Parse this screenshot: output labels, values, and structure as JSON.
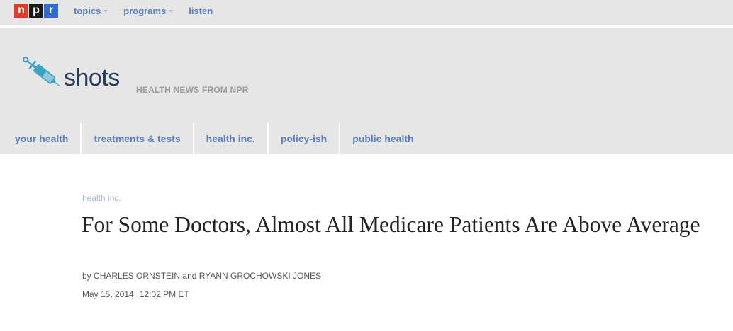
{
  "topbar": {
    "logo": {
      "n": "n",
      "p": "p",
      "r": "r"
    },
    "nav": [
      {
        "label": "topics",
        "has_dropdown": true
      },
      {
        "label": "programs",
        "has_dropdown": true
      },
      {
        "label": "listen",
        "has_dropdown": false
      }
    ]
  },
  "header": {
    "brand_word": "shots",
    "tagline": "HEALTH NEWS FROM NPR",
    "icon": "syringe-icon",
    "sections": [
      {
        "label": "your health"
      },
      {
        "label": "treatments & tests"
      },
      {
        "label": "health inc."
      },
      {
        "label": "policy-ish"
      },
      {
        "label": "public health"
      }
    ]
  },
  "article": {
    "kicker": "health inc.",
    "headline": "For Some Doctors, Almost All Medicare Patients Are Above Average",
    "byline_prefix": "by",
    "author1": "CHARLES ORNSTEIN",
    "byline_joiner": "and",
    "author2": "RYANN GROCHOWSKI JONES",
    "date": "May 15, 2014",
    "time": "12:02 PM ET"
  },
  "colors": {
    "nav_link": "#5a7fc0",
    "header_bg": "#e6e6e6",
    "brand_text": "#283c5a",
    "npr_n": "#e23b2b",
    "npr_p": "#1a1a1a",
    "npr_r": "#2f6bd0",
    "syringe": "#3aa3c2"
  }
}
